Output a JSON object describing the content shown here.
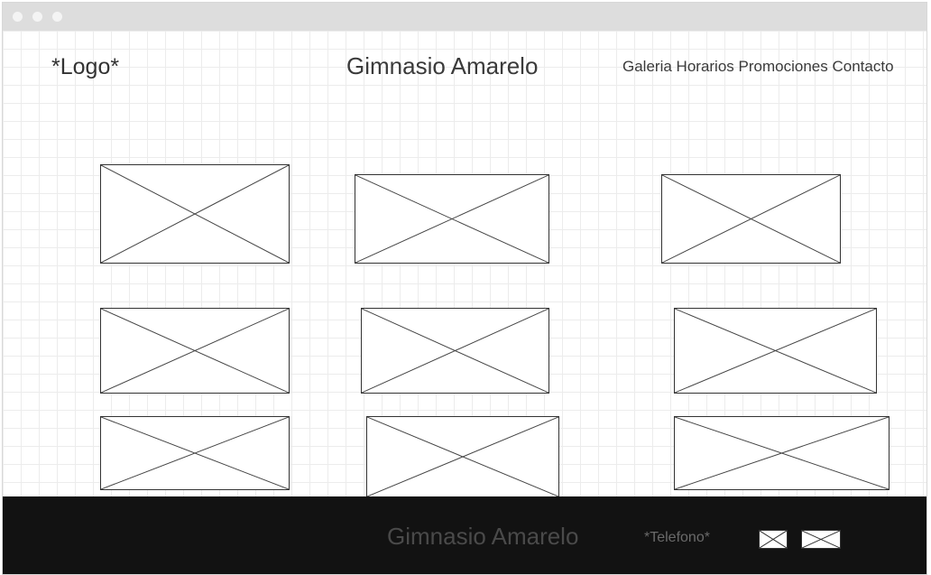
{
  "header": {
    "logo": "*Logo*",
    "title": "Gimnasio Amarelo",
    "nav": [
      "Galeria",
      "Horarios",
      "Promociones",
      "Contacto"
    ]
  },
  "gallery": {
    "image_count": 9,
    "image_icon": "image-placeholder-icon"
  },
  "footer": {
    "title": "Gimnasio Amarelo",
    "phone": "*Telefono*",
    "social_icons": [
      "social-icon-placeholder",
      "social-icon-placeholder"
    ]
  },
  "colors": {
    "footer_bg": "#121212",
    "text": "#3a3a3a",
    "footer_text": "#4a4a4a"
  }
}
